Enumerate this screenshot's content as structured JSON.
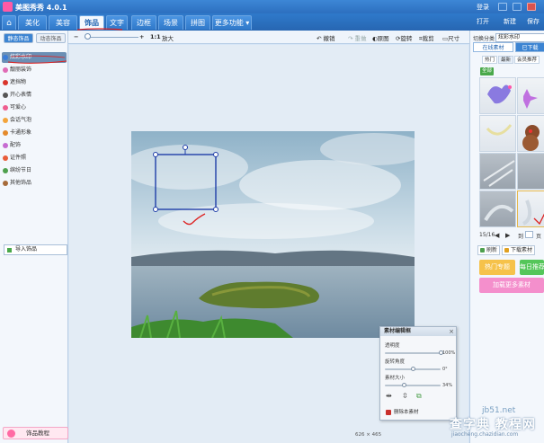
{
  "app": {
    "title": "美图秀秀 4.0.1",
    "login": "登录"
  },
  "menu": {
    "tabs": [
      {
        "label": "⌂",
        "name": "home"
      },
      {
        "label": "美化",
        "name": "beautify"
      },
      {
        "label": "美容",
        "name": "beauty"
      },
      {
        "label": "饰品",
        "name": "accessories"
      },
      {
        "label": "文字",
        "name": "text"
      },
      {
        "label": "边框",
        "name": "border"
      },
      {
        "label": "场景",
        "name": "scene"
      },
      {
        "label": "拼图",
        "name": "collage"
      },
      {
        "label": "更多功能",
        "name": "more"
      }
    ],
    "active_tab": "饰品",
    "open": "打开",
    "new": "新建",
    "save": "保存"
  },
  "toolbar": {
    "zoom_ratio": "1:1",
    "zoom_enlarge": "放大",
    "undo": "撤销",
    "redo": "重做",
    "original": "原图",
    "rotate": "旋转",
    "crop": "裁剪",
    "size": "尺寸"
  },
  "left_panel": {
    "tab_static": "静态饰品",
    "tab_animated": "动态饰品",
    "items": [
      {
        "label": "炫彩水印",
        "color": "#3b7dd8",
        "active": true
      },
      {
        "label": "靓丽装饰",
        "color": "#e06cb6"
      },
      {
        "label": "遮挡物",
        "color": "#d9342b"
      },
      {
        "label": "开心表情",
        "color": "#555555"
      },
      {
        "label": "可爱心",
        "color": "#ee5d8f"
      },
      {
        "label": "会话气泡",
        "color": "#f3a43b"
      },
      {
        "label": "卡通形象",
        "color": "#e48a2c"
      },
      {
        "label": "配饰",
        "color": "#c66bd1"
      },
      {
        "label": "证件照",
        "color": "#e85c3a"
      },
      {
        "label": "缤纷节日",
        "color": "#4ea04e"
      },
      {
        "label": "其他饰品",
        "color": "#a66b3a"
      }
    ],
    "import_button": "导入饰品",
    "tutorial_button": "饰品教程"
  },
  "status": {
    "image_size": "626 × 465"
  },
  "editor": {
    "title": "素材编辑框",
    "opacity_label": "透明度",
    "opacity_value": "100%",
    "opacity": 1.0,
    "rotation_label": "旋转角度",
    "rotation_value": "0°",
    "rotation": 0.5,
    "size_label": "素材大小",
    "size_value": "34%",
    "size": 0.34,
    "delete_button": "删除本素材"
  },
  "right_panel": {
    "category_label": "切换分类",
    "category_value": "炫彩水印",
    "tab_online": "在线素材",
    "tab_mine": "已下载",
    "subtabs": [
      "热门",
      "最新",
      "会员推荐"
    ],
    "active_subtab": "最新",
    "tag_label": "全部",
    "pager_text": "15/16",
    "pager_goto": "到",
    "pager_page": "页",
    "refresh": "刷新",
    "download": "下载素材",
    "big_buttons": [
      {
        "label": "热门专题",
        "color": "#f6c24a"
      },
      {
        "label": "每日推荐",
        "color": "#55c65a"
      },
      {
        "label": "加载更多素材",
        "color": "#f48fcc"
      }
    ]
  },
  "watermark": {
    "line1": "jb51.net",
    "line2": "查字典 教程网",
    "line3": "jiaocheng.chazidian.com"
  }
}
